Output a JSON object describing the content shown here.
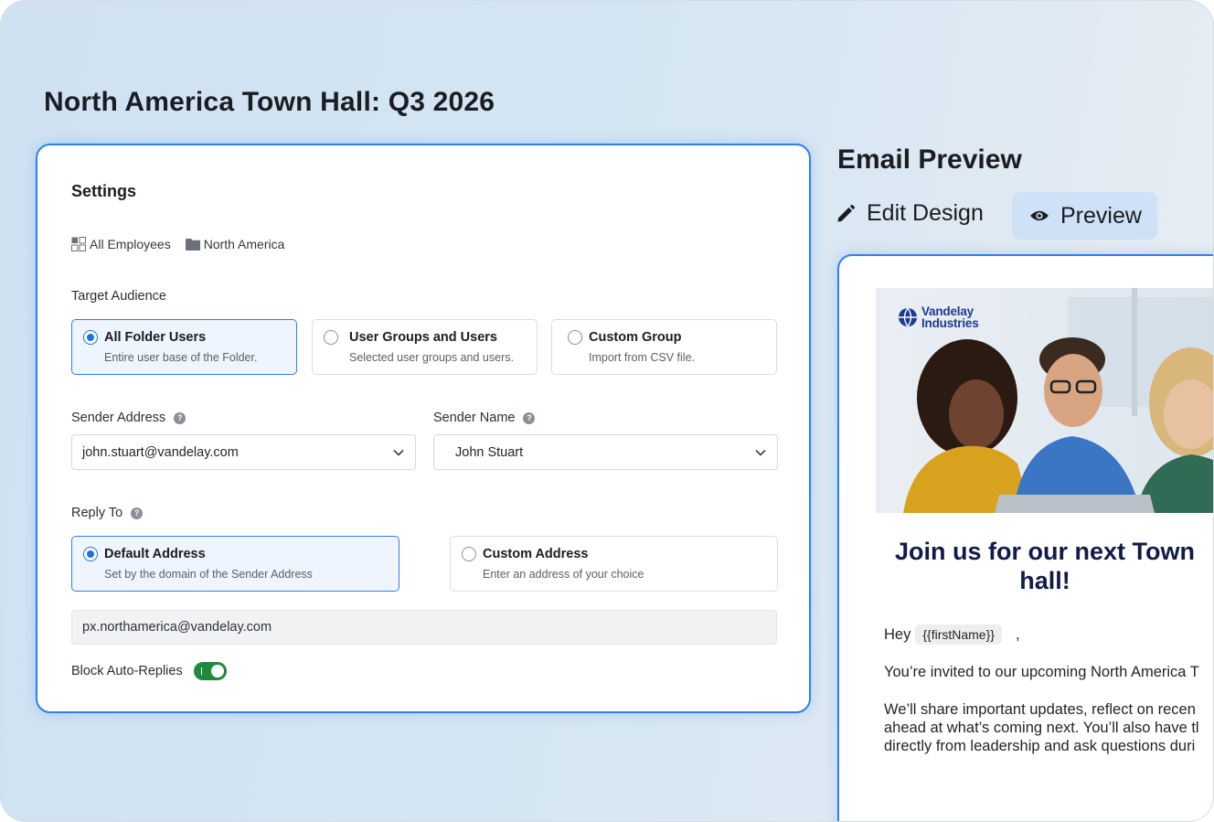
{
  "page_title": "North America Town Hall: Q3 2026",
  "settings": {
    "title": "Settings",
    "breadcrumb": [
      {
        "label": "All Employees",
        "icon": "grid-icon"
      },
      {
        "label": "North America",
        "icon": "folder-icon"
      }
    ],
    "target_audience": {
      "label": "Target Audience",
      "options": [
        {
          "title": "All Folder Users",
          "subtitle": "Entire user base of the Folder.",
          "selected": true
        },
        {
          "title": "User Groups and Users",
          "subtitle": "Selected user groups and users.",
          "selected": false
        },
        {
          "title": "Custom Group",
          "subtitle": "Import from CSV file.",
          "selected": false
        }
      ]
    },
    "sender_address": {
      "label": "Sender Address",
      "value": "john.stuart@vandelay.com"
    },
    "sender_name": {
      "label": "Sender Name",
      "value": "John Stuart"
    },
    "reply_to": {
      "label": "Reply To",
      "options": [
        {
          "title": "Default Address",
          "subtitle": "Set by the domain of the Sender Address",
          "selected": true
        },
        {
          "title": "Custom Address",
          "subtitle": "Enter an address of your choice",
          "selected": false
        }
      ],
      "address": "px.northamerica@vandelay.com"
    },
    "block_auto_replies": {
      "label": "Block Auto-Replies",
      "enabled": true
    }
  },
  "email_preview": {
    "title": "Email Preview",
    "edit_design_label": "Edit Design",
    "preview_label": "Preview",
    "brand": {
      "line1": "Vandelay",
      "line2": "Industries"
    },
    "headline": "Join us for our next Town hall!",
    "greeting": "Hey",
    "placeholder_token": "{{firstName}}",
    "greeting_suffix": ",",
    "paragraph1": "You’re invited to our upcoming North America T",
    "paragraph2_lines": [
      "We’ll share important updates, reflect on recen",
      "ahead at what’s coming next. You’ll also have tl",
      "directly from leadership and ask questions duri"
    ]
  },
  "colors": {
    "accent": "#2d7ff0",
    "radio_selected": "#1a73e8",
    "toggle_on": "#1e8a3c",
    "headline": "#121a4a",
    "brand": "#1f3b8c"
  }
}
